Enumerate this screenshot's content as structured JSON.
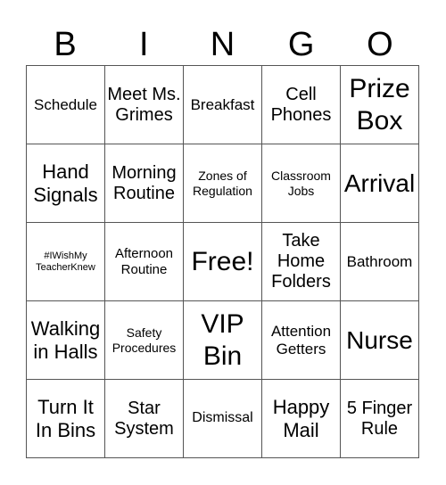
{
  "header": {
    "letters": [
      "B",
      "I",
      "N",
      "G",
      "O"
    ]
  },
  "board": {
    "cells": [
      [
        "Schedule",
        "Meet Ms. Grimes",
        "Breakfast",
        "Cell Phones",
        "Prize Box"
      ],
      [
        "Hand Signals",
        "Morning Routine",
        "Zones of Regulation",
        "Classroom Jobs",
        "Arrival"
      ],
      [
        "#IWishMy TeacherKnew",
        "Afternoon Routine",
        "Free!",
        "Take Home Folders",
        "Bathroom"
      ],
      [
        "Walking in Halls",
        "Safety Procedures",
        "VIP Bin",
        "Attention Getters",
        "Nurse"
      ],
      [
        "Turn It In Bins",
        "Star System",
        "Dismissal",
        "Happy Mail",
        "5 Finger Rule"
      ]
    ]
  }
}
